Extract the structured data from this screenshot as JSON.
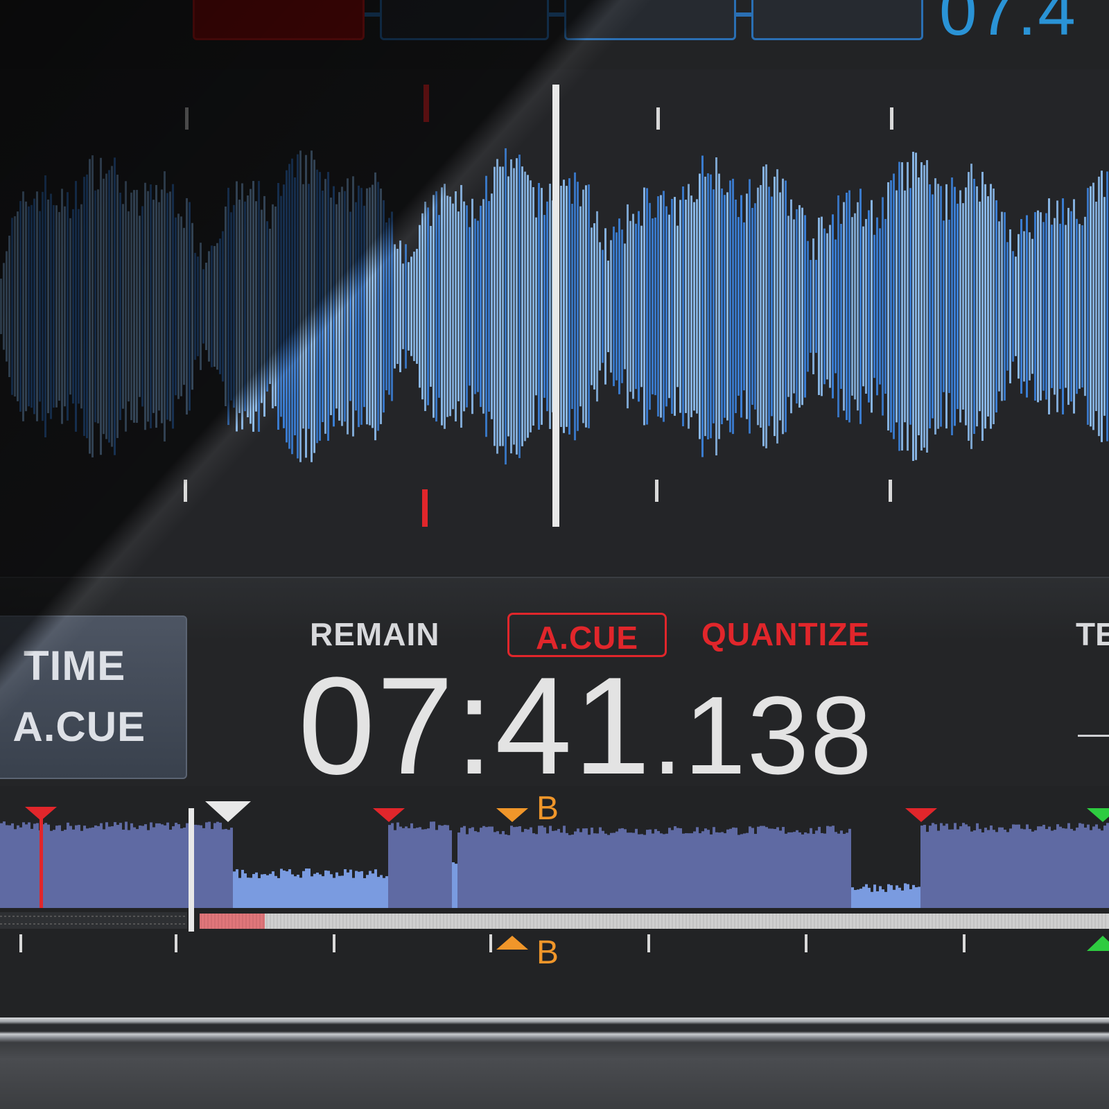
{
  "top_bar": {
    "time_partial": "07.4"
  },
  "info": {
    "time_mode_line1": "TIME",
    "time_mode_line2": "- A.CUE",
    "remain": "REMAIN",
    "acue": "A.CUE",
    "quantize": "QUANTIZE",
    "tempo_partial": "TE",
    "time_main": "07:41",
    "time_ms": ".138"
  },
  "overview": {
    "memory_marker_label_top": "B",
    "memory_marker_label_bottom": "B",
    "played_fraction": 0.06
  },
  "colors": {
    "waveform_blue": "#3b7fd6",
    "waveform_light": "#8ab8e8",
    "cue_red": "#e1262b",
    "hotcue_orange": "#f0962a",
    "loop_green": "#2ecc40",
    "overview_fill": "#5f6aa3",
    "overview_low": "#7a9be0",
    "accent_blue": "#2a93d6"
  }
}
